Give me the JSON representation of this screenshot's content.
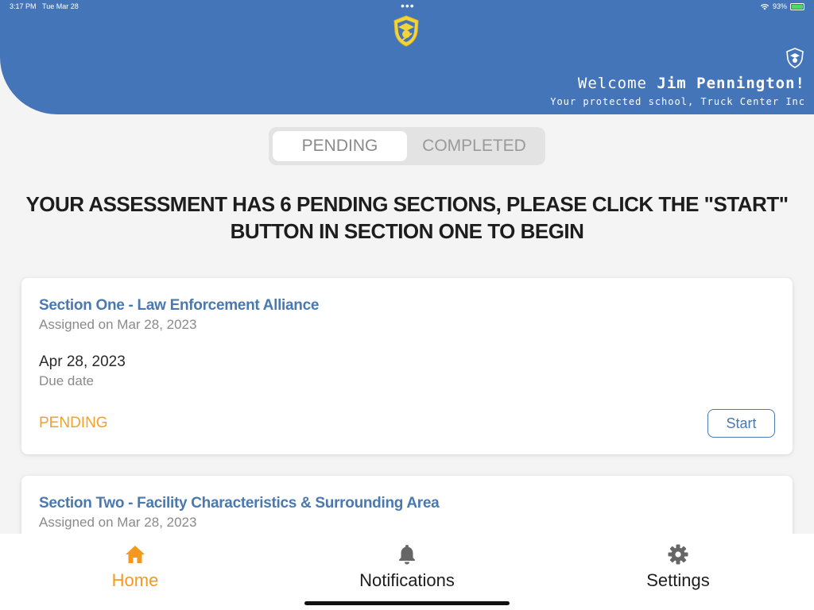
{
  "status_bar": {
    "time": "3:17 PM",
    "date": "Tue Mar 28",
    "battery": "93%"
  },
  "header": {
    "welcome_prefix": "Welcome ",
    "user_name": "Jim Pennington!",
    "subtitle": "Your protected school, Truck Center Inc"
  },
  "tabs": {
    "pending": "PENDING",
    "completed": "COMPLETED"
  },
  "headline": "YOUR ASSESSMENT HAS 6 PENDING SECTIONS, PLEASE CLICK THE \"START\" BUTTON IN SECTION ONE  TO BEGIN",
  "sections": [
    {
      "title": "Section One - Law Enforcement Alliance",
      "assigned": "Assigned on Mar 28, 2023",
      "due_date": "Apr 28, 2023",
      "due_label": "Due date",
      "status": "PENDING",
      "button": "Start"
    },
    {
      "title": "Section Two - Facility Characteristics & Surrounding Area",
      "assigned": "Assigned on Mar 28, 2023"
    }
  ],
  "bottom_nav": {
    "home": "Home",
    "notifications": "Notifications",
    "settings": "Settings"
  },
  "colors": {
    "header": "#4575b9",
    "accent": "#f39a1e",
    "link": "#4a78b0"
  },
  "icons": [
    "shield-logo-icon",
    "home-icon",
    "bell-icon",
    "gear-icon",
    "wifi-icon",
    "battery-icon"
  ]
}
